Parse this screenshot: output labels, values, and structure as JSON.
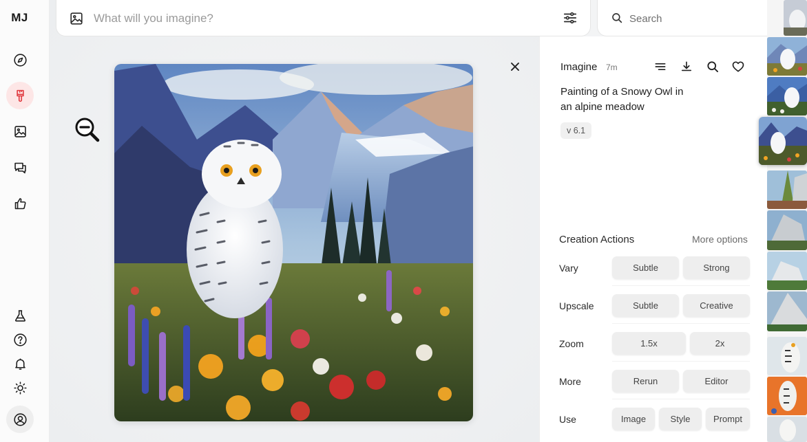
{
  "app": {
    "logo": "MJ"
  },
  "nav": {
    "items": [
      {
        "name": "explore",
        "icon": "compass-icon"
      },
      {
        "name": "create",
        "icon": "paintbrush-icon",
        "active": true
      },
      {
        "name": "organize",
        "icon": "image-icon"
      },
      {
        "name": "chat",
        "icon": "chat-bubbles-icon"
      },
      {
        "name": "rank",
        "icon": "thumbs-up-icon"
      },
      {
        "name": "labs",
        "icon": "flask-icon"
      },
      {
        "name": "help",
        "icon": "help-circle-icon"
      },
      {
        "name": "notifications",
        "icon": "bell-icon"
      },
      {
        "name": "theme",
        "icon": "sun-icon"
      },
      {
        "name": "account",
        "icon": "user-circle-icon"
      }
    ]
  },
  "prompt_bar": {
    "placeholder": "What will you imagine?",
    "value": ""
  },
  "search": {
    "placeholder": "Search",
    "value": ""
  },
  "details": {
    "title": "Imagine",
    "age": "7m",
    "prompt": "Painting of a Snowy Owl in an alpine meadow",
    "version": "v 6.1",
    "icons": [
      "list-icon",
      "download-icon",
      "search-icon",
      "heart-icon"
    ]
  },
  "actions": {
    "title": "Creation Actions",
    "more_options": "More options",
    "vary": {
      "label": "Vary",
      "subtle": "Subtle",
      "strong": "Strong"
    },
    "upscale": {
      "label": "Upscale",
      "subtle": "Subtle",
      "creative": "Creative"
    },
    "zoom": {
      "label": "Zoom",
      "z15": "1.5x",
      "z2": "2x"
    },
    "more": {
      "label": "More",
      "rerun": "Rerun",
      "editor": "Editor"
    },
    "use": {
      "label": "Use",
      "image": "Image",
      "style": "Style",
      "prompt": "Prompt"
    }
  },
  "colors": {
    "accent_active": "#fde6e6",
    "accent_icon": "#e0383e",
    "button_bg": "#eeeeee"
  }
}
